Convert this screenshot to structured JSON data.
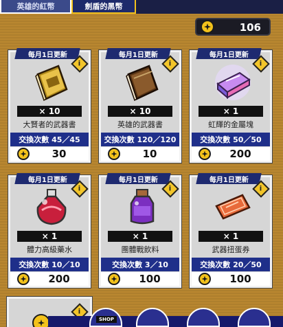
{
  "tabs": {
    "red_label": "英雄的紅幣",
    "black_label": "劍盾的黑幣"
  },
  "currency": {
    "icon": "coin-icon",
    "value": "106"
  },
  "items": [
    {
      "banner": "每月1日更新",
      "qty": "× 10",
      "name": "大賢者的武器書",
      "exchange": "交換次數 45／45",
      "price": "30",
      "icon": "golden-book-icon"
    },
    {
      "banner": "每月1日更新",
      "qty": "× 10",
      "name": "英雄的武器書",
      "exchange": "交換次數 120／120",
      "price": "10",
      "icon": "brown-book-icon"
    },
    {
      "banner": "每月1日更新",
      "qty": "× 1",
      "name": "虹輝的金屬塊",
      "exchange": "交換次數 50／50",
      "price": "200",
      "icon": "rainbow-metal-icon"
    },
    {
      "banner": "每月1日更新",
      "qty": "× 1",
      "name": "體力高級藥水",
      "exchange": "交換次數 10／10",
      "price": "200",
      "icon": "potion-icon"
    },
    {
      "banner": "每月1日更新",
      "qty": "× 1",
      "name": "團體戰飲料",
      "exchange": "交換次數 3／10",
      "price": "100",
      "icon": "purple-bottle-icon"
    },
    {
      "banner": "每月1日更新",
      "qty": "× 1",
      "name": "武器扭蛋券",
      "exchange": "交換次數 20／50",
      "price": "100",
      "icon": "ticket-icon"
    }
  ],
  "bottom_nav": {
    "shop_label": "SHOP"
  },
  "colors": {
    "background": "#b98730",
    "banner": "#1e2a70",
    "exchange_bar": "#1f2f8a",
    "coin": "#f3c21b"
  }
}
